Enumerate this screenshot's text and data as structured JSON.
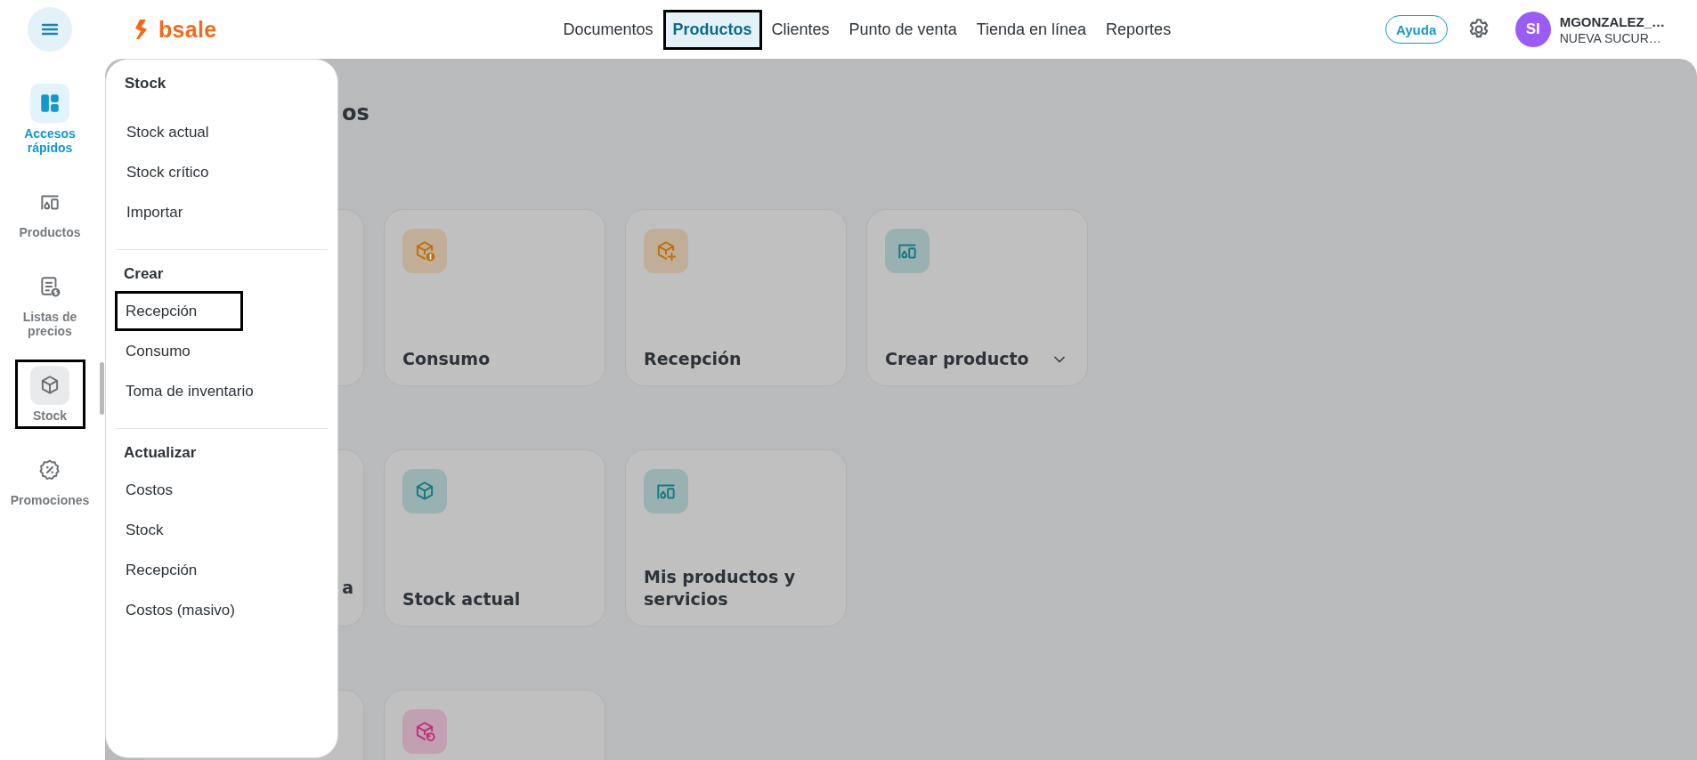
{
  "topbar": {
    "logo": "bsale",
    "nav": [
      {
        "label": "Documentos",
        "selected": false,
        "highlighted": false
      },
      {
        "label": "Productos",
        "selected": true,
        "highlighted": true
      },
      {
        "label": "Clientes",
        "selected": false,
        "highlighted": false
      },
      {
        "label": "Punto de venta",
        "selected": false,
        "highlighted": false
      },
      {
        "label": "Tienda en línea",
        "selected": false,
        "highlighted": false
      },
      {
        "label": "Reportes",
        "selected": false,
        "highlighted": false
      }
    ],
    "help_button": "Ayuda",
    "user": {
      "initials": "SI",
      "name": "MGONZALEZ_…",
      "branch": "NUEVA SUCUR…"
    }
  },
  "sidebar": {
    "items": [
      {
        "label": "Accesos rápidos",
        "selected": true,
        "open": false,
        "highlighted": false
      },
      {
        "label": "Productos",
        "selected": false,
        "open": false,
        "highlighted": false
      },
      {
        "label": "Listas de precios",
        "selected": false,
        "open": false,
        "highlighted": false
      },
      {
        "label": "Stock",
        "selected": false,
        "open": true,
        "highlighted": true
      },
      {
        "label": "Promociones",
        "selected": false,
        "open": false,
        "highlighted": false
      }
    ]
  },
  "stock_menu": {
    "sections": [
      {
        "title": "Stock",
        "items": [
          {
            "label": "Stock actual",
            "highlighted": false
          },
          {
            "label": "Stock crítico",
            "highlighted": false
          },
          {
            "label": "Importar",
            "highlighted": false
          }
        ]
      },
      {
        "title": "Crear",
        "items": [
          {
            "label": "Recepción",
            "highlighted": true
          },
          {
            "label": "Consumo",
            "highlighted": false
          },
          {
            "label": "Toma de inventario",
            "highlighted": false
          }
        ]
      },
      {
        "title": "Actualizar",
        "items": [
          {
            "label": "Costos",
            "highlighted": false
          },
          {
            "label": "Stock",
            "highlighted": false
          },
          {
            "label": "Recepción",
            "highlighted": false
          },
          {
            "label": "Costos (masivo)",
            "highlighted": false
          }
        ]
      }
    ]
  },
  "main": {
    "title": "os",
    "rows": [
      {
        "cards": [
          {
            "kind": "partial"
          },
          {
            "kind": "card",
            "label": "Consumo",
            "color": "#c26e0c",
            "dropdown": false
          },
          {
            "kind": "card",
            "label": "Recepción",
            "color": "#c26e0c",
            "dropdown": false
          },
          {
            "kind": "card",
            "label": "Crear producto",
            "color": "#137a82",
            "dropdown": true
          }
        ]
      },
      {
        "cards": [
          {
            "kind": "partial",
            "label": "a"
          },
          {
            "kind": "card",
            "label": "Stock actual",
            "color": "#137a82",
            "dropdown": false
          },
          {
            "kind": "card",
            "label": "Mis productos y servicios",
            "color": "#137a82",
            "dropdown": false
          }
        ]
      },
      {
        "cards": [
          {
            "kind": "partial"
          },
          {
            "kind": "card",
            "color": "#c0307a",
            "dropdown": false
          }
        ]
      }
    ]
  }
}
